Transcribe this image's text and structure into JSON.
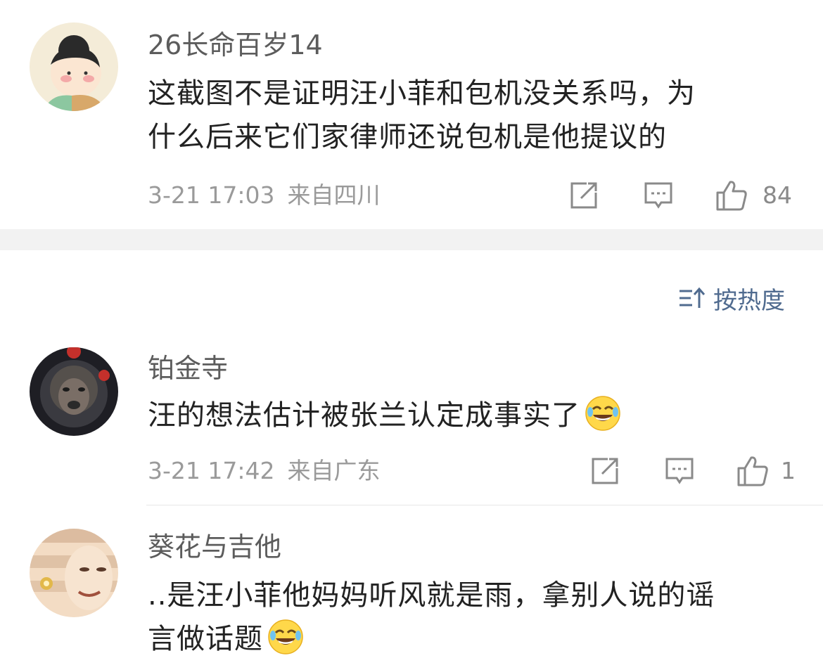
{
  "comments": [
    {
      "username": "26长命百岁14",
      "text_line1": "这截图不是证明汪小菲和包机没关系吗，为",
      "text_line2": "什么后来它们家律师还说包机是他提议的",
      "time": "3-21 17:03",
      "location": "来自四川",
      "likes": "84"
    },
    {
      "username": "铂金寺",
      "text": "汪的想法估计被张兰认定成事实了",
      "time": "3-21 17:42",
      "location": "来自广东",
      "likes": "1"
    },
    {
      "username": "葵花与吉他",
      "text_line1": "..是汪小菲他妈妈听风就是雨，拿别人说的谣",
      "text_line2": "言做话题"
    }
  ],
  "sort": {
    "label": "按热度"
  },
  "icons": {
    "share": "share-icon",
    "comment": "comment-icon",
    "like": "thumbs-up-icon",
    "sort": "sort-icon",
    "emoji": "laugh-cry-emoji-icon"
  },
  "colors": {
    "username": "#5c5c5c",
    "text": "#222222",
    "meta": "#9a9a9a",
    "accent": "#506b8f",
    "separator": "#f2f2f2"
  }
}
